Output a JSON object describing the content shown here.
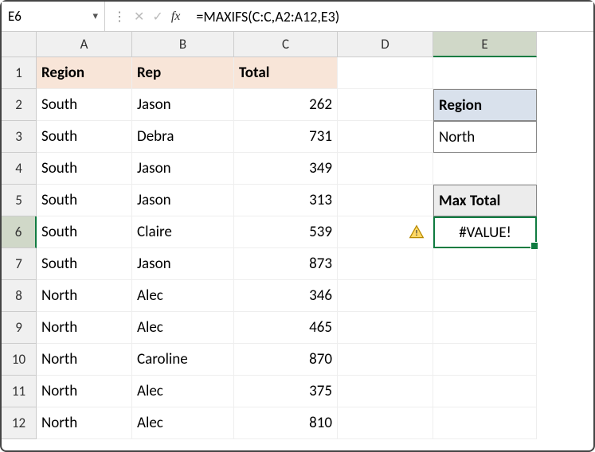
{
  "nameBox": "E6",
  "formula": "=MAXIFS(C:C,A2:A12,E3)",
  "columns": [
    "A",
    "B",
    "C",
    "D",
    "E"
  ],
  "headers": {
    "A": "Region",
    "B": "Rep",
    "C": "Total"
  },
  "rows": [
    {
      "r": "1"
    },
    {
      "r": "2",
      "A": "South",
      "B": "Jason",
      "C": "262"
    },
    {
      "r": "3",
      "A": "South",
      "B": "Debra",
      "C": "731"
    },
    {
      "r": "4",
      "A": "South",
      "B": "Jason",
      "C": "349"
    },
    {
      "r": "5",
      "A": "South",
      "B": "Jason",
      "C": "313"
    },
    {
      "r": "6",
      "A": "South",
      "B": "Claire",
      "C": "539"
    },
    {
      "r": "7",
      "A": "South",
      "B": "Jason",
      "C": "873"
    },
    {
      "r": "8",
      "A": "North",
      "B": "Alec",
      "C": "346"
    },
    {
      "r": "9",
      "A": "North",
      "B": "Alec",
      "C": "465"
    },
    {
      "r": "10",
      "A": "North",
      "B": "Caroline",
      "C": "870"
    },
    {
      "r": "11",
      "A": "North",
      "B": "Alec",
      "C": "375"
    },
    {
      "r": "12",
      "A": "North",
      "B": "Alec",
      "C": "810"
    }
  ],
  "side": {
    "E2": "Region",
    "E3": "North",
    "E5": "Max Total",
    "E6": "#VALUE!"
  }
}
